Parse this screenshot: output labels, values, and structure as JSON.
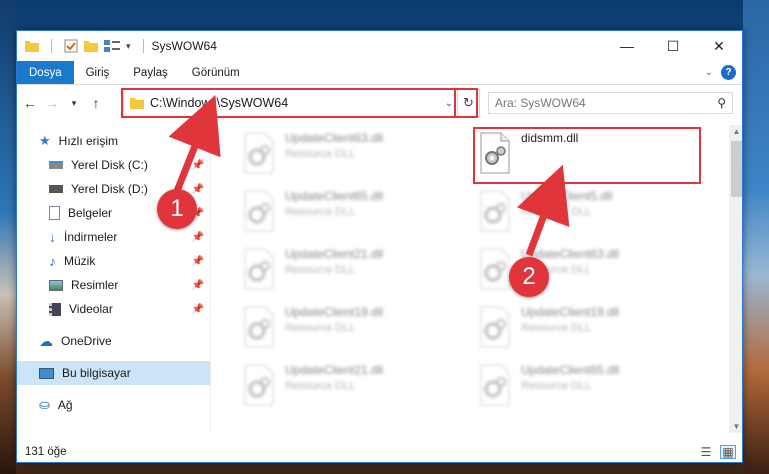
{
  "window": {
    "title": "SysWOW64",
    "minimize": "—",
    "maximize": "☐",
    "close": "✕"
  },
  "ribbon": {
    "tabs": [
      "Dosya",
      "Giriş",
      "Paylaş",
      "Görünüm"
    ],
    "active_tab": "Dosya",
    "help": "?"
  },
  "address": {
    "path": "C:\\Windows\\SysWOW64"
  },
  "search": {
    "placeholder": "Ara: SysWOW64"
  },
  "nav": {
    "quick_access": "Hızlı erişim",
    "items": [
      {
        "label": "Yerel Disk (C:)",
        "icon": "drive-icon",
        "pinned": true
      },
      {
        "label": "Yerel Disk (D:)",
        "icon": "drive-icon",
        "pinned": true
      },
      {
        "label": "Belgeler",
        "icon": "documents-icon",
        "pinned": true
      },
      {
        "label": "İndirmeler",
        "icon": "download-icon",
        "pinned": true
      },
      {
        "label": "Müzik",
        "icon": "music-icon",
        "pinned": true
      },
      {
        "label": "Resimler",
        "icon": "pictures-icon",
        "pinned": true
      },
      {
        "label": "Videolar",
        "icon": "videos-icon",
        "pinned": true
      }
    ],
    "onedrive": "OneDrive",
    "this_pc": "Bu bilgisayar",
    "network": "Ağ"
  },
  "files": {
    "highlighted": {
      "name": "didsmm.dll",
      "type": ""
    },
    "left_column": [
      {
        "name": "UpdateClient63.dll",
        "type": "Resource DLL"
      },
      {
        "name": "UpdateClient65.dll",
        "type": "Resource DLL"
      },
      {
        "name": "UpdateClient21.dll",
        "type": "Resource DLL"
      },
      {
        "name": "UpdateClient19.dll",
        "type": "Resource DLL"
      },
      {
        "name": "UpdateClient21.dll",
        "type": "Resource DLL"
      }
    ],
    "right_column": [
      {
        "name": "UpdateClient5.dll",
        "type": "Resource DLL"
      },
      {
        "name": "UpdateClient63.dll",
        "type": "Resource DLL"
      },
      {
        "name": "UpdateClient19.dll",
        "type": "Resource DLL"
      },
      {
        "name": "UpdateClient65.dll",
        "type": "Resource DLL"
      }
    ]
  },
  "status": {
    "count": "131 öğe"
  },
  "annotations": {
    "step1": "1",
    "step2": "2",
    "color": "#e0353b"
  }
}
